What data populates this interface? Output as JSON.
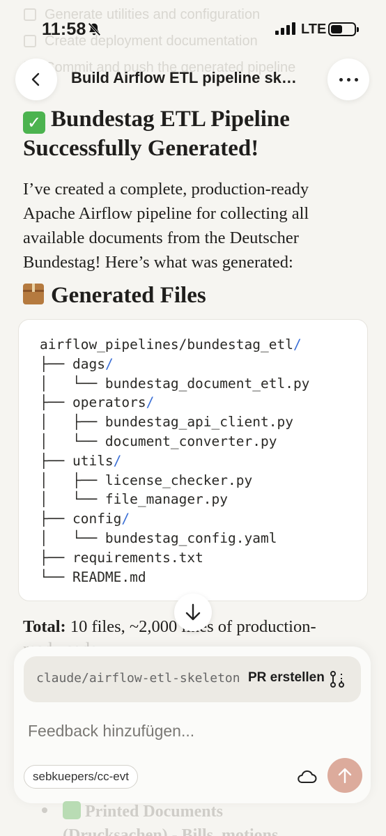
{
  "background_tasks": [
    "Generate utilities and configuration",
    "Create deployment documentation",
    "Commit and push the generated pipeline"
  ],
  "status_bar": {
    "time": "11:58",
    "network": "LTE"
  },
  "header": {
    "title": "Build Airflow ETL pipeline sk…"
  },
  "message": {
    "heading": "Bundestag ETL Pipeline Successfully Generated!",
    "intro": "I’ve created a complete, production-ready Apache Airflow pipeline for collecting all available documents from the Deutscher Bundestag! Here’s what was generated:",
    "files_heading": "Generated Files",
    "file_tree": {
      "root": "airflow_pipelines/bundestag_etl",
      "dags": "dags",
      "dag_file": "bundestag_document_etl.py",
      "operators": "operators",
      "op_file1": "bundestag_api_client.py",
      "op_file2": "document_converter.py",
      "utils": "utils",
      "util_file1": "license_checker.py",
      "util_file2": "file_manager.py",
      "config": "config",
      "config_file": "bundestag_config.yaml",
      "requirements": "requirements.txt",
      "readme": "README.md"
    },
    "total_label": "Total:",
    "total_text": " 10 files, ~2,000 lines of production-",
    "total_text_2": "ready code"
  },
  "composer": {
    "branch": "claude/airflow-etl-skeleton",
    "pr_button": "PR erstellen",
    "feedback_placeholder": "Feedback hinzufügen...",
    "repo": "sebkuepers/cc-evt"
  },
  "below_content": {
    "item1": "Printed Documents",
    "item1_line2": "(Drucksachen) - Bills, motions"
  }
}
